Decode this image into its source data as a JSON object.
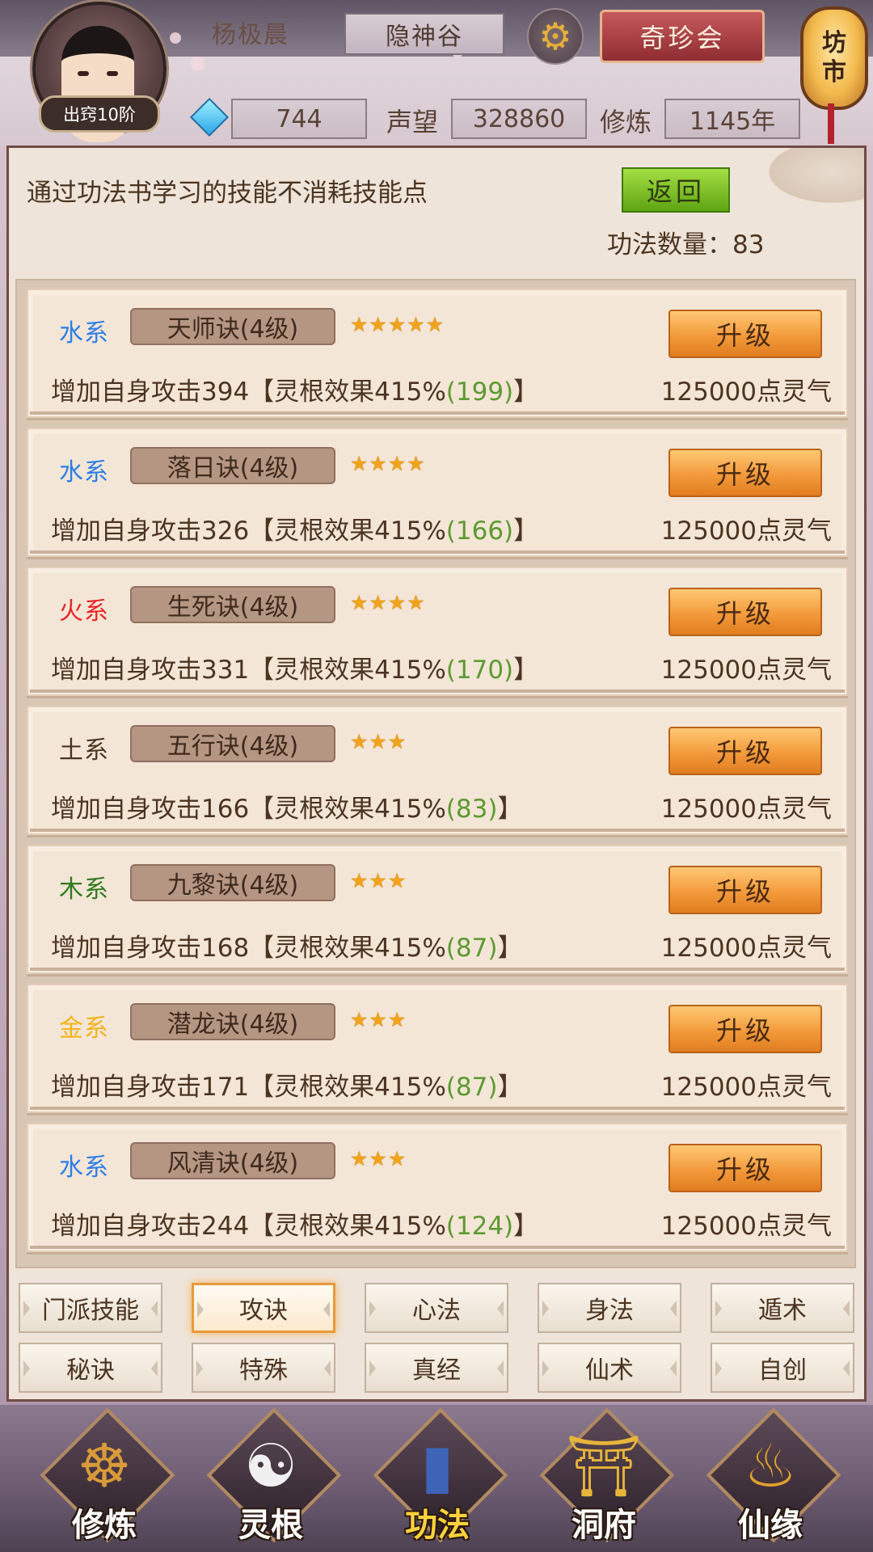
{
  "header": {
    "rank_badge": "出窍10阶",
    "player_name": "杨极晨",
    "sect": "隐神谷",
    "treasure_button": "奇珍会",
    "lantern_text": [
      "坊",
      "市"
    ],
    "gem_value": "744",
    "reputation_label": "声望",
    "reputation_value": "328860",
    "cultivation_label": "修炼",
    "cultivation_value": "1145年"
  },
  "panel": {
    "hint": "通过功法书学习的技能不消耗技能点",
    "back_button": "返回",
    "count_label": "功法数量：83"
  },
  "colors": {
    "water": "#2d7ee8",
    "fire": "#e82424",
    "earth": "#4b3420",
    "wood": "#2f7a1e",
    "metal": "#f2b31c",
    "green_value": "#5d9a32",
    "upgrade_orange": "#f39a3b"
  },
  "skills": [
    {
      "element": "水系",
      "element_color": "#2d7ee8",
      "name": "天师诀(4级)",
      "stars": "★★★★★",
      "upgrade": "升级",
      "effect_prefix": "增加自身攻击394【灵根效果415%",
      "effect_bonus": "(199)",
      "effect_suffix": "】",
      "cost": "125000点灵气"
    },
    {
      "element": "水系",
      "element_color": "#2d7ee8",
      "name": "落日诀(4级)",
      "stars": "★★★★",
      "upgrade": "升级",
      "effect_prefix": "增加自身攻击326【灵根效果415%",
      "effect_bonus": "(166)",
      "effect_suffix": "】",
      "cost": "125000点灵气"
    },
    {
      "element": "火系",
      "element_color": "#e82424",
      "name": "生死诀(4级)",
      "stars": "★★★★",
      "upgrade": "升级",
      "effect_prefix": "增加自身攻击331【灵根效果415%",
      "effect_bonus": "(170)",
      "effect_suffix": "】",
      "cost": "125000点灵气"
    },
    {
      "element": "土系",
      "element_color": "#4b3420",
      "name": "五行诀(4级)",
      "stars": "★★★",
      "upgrade": "升级",
      "effect_prefix": "增加自身攻击166【灵根效果415%",
      "effect_bonus": "(83)",
      "effect_suffix": "】",
      "cost": "125000点灵气"
    },
    {
      "element": "木系",
      "element_color": "#2f7a1e",
      "name": "九黎诀(4级)",
      "stars": "★★★",
      "upgrade": "升级",
      "effect_prefix": "增加自身攻击168【灵根效果415%",
      "effect_bonus": "(87)",
      "effect_suffix": "】",
      "cost": "125000点灵气"
    },
    {
      "element": "金系",
      "element_color": "#f2b31c",
      "name": "潜龙诀(4级)",
      "stars": "★★★",
      "upgrade": "升级",
      "effect_prefix": "增加自身攻击171【灵根效果415%",
      "effect_bonus": "(87)",
      "effect_suffix": "】",
      "cost": "125000点灵气"
    },
    {
      "element": "水系",
      "element_color": "#2d7ee8",
      "name": "风清诀(4级)",
      "stars": "★★★",
      "upgrade": "升级",
      "effect_prefix": "增加自身攻击244【灵根效果415%",
      "effect_bonus": "(124)",
      "effect_suffix": "】",
      "cost": "125000点灵气"
    }
  ],
  "tabs": [
    {
      "label": "门派技能",
      "active": false
    },
    {
      "label": "攻诀",
      "active": true
    },
    {
      "label": "心法",
      "active": false
    },
    {
      "label": "身法",
      "active": false
    },
    {
      "label": "遁术",
      "active": false
    },
    {
      "label": "秘诀",
      "active": false
    },
    {
      "label": "特殊",
      "active": false
    },
    {
      "label": "真经",
      "active": false
    },
    {
      "label": "仙术",
      "active": false
    },
    {
      "label": "自创",
      "active": false
    }
  ],
  "nav": [
    {
      "label": "修炼",
      "icon": "cultivation-icon",
      "active": false
    },
    {
      "label": "灵根",
      "icon": "spirit-root-icon",
      "active": false
    },
    {
      "label": "功法",
      "icon": "technique-book-icon",
      "active": true
    },
    {
      "label": "洞府",
      "icon": "cave-dwelling-icon",
      "active": false
    },
    {
      "label": "仙缘",
      "icon": "immortal-fate-icon",
      "active": false
    }
  ]
}
